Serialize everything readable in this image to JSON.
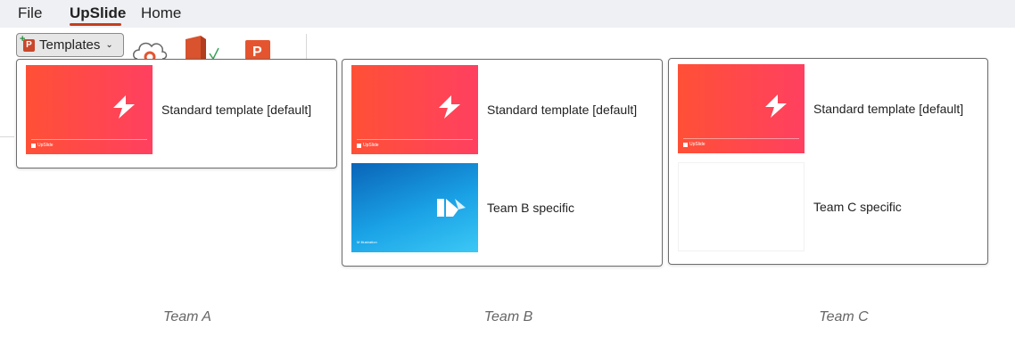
{
  "ribbon": {
    "tabs": [
      {
        "label": "File",
        "active": false
      },
      {
        "label": "UpSlide",
        "active": true
      },
      {
        "label": "Home",
        "active": false
      }
    ],
    "templates_button": {
      "label": "Templates",
      "icon": "templates-icon"
    },
    "accent_color": "#c43e1c"
  },
  "panels": [
    {
      "team": "Team A",
      "items": [
        {
          "label": "Standard template [default]",
          "thumbnail": "red",
          "footer": "UpSlide"
        }
      ]
    },
    {
      "team": "Team B",
      "items": [
        {
          "label": "Standard template [default]",
          "thumbnail": "red",
          "footer": "UpSlide"
        },
        {
          "label": "Team B specific",
          "thumbnail": "blue",
          "footer": "M Illustration"
        }
      ]
    },
    {
      "team": "Team C",
      "items": [
        {
          "label": "Standard template [default]",
          "thumbnail": "red",
          "footer": "UpSlide"
        },
        {
          "label": "Team C specific",
          "thumbnail": "blank",
          "footer": ""
        }
      ]
    }
  ],
  "captions": [
    "Team A",
    "Team B",
    "Team C"
  ]
}
